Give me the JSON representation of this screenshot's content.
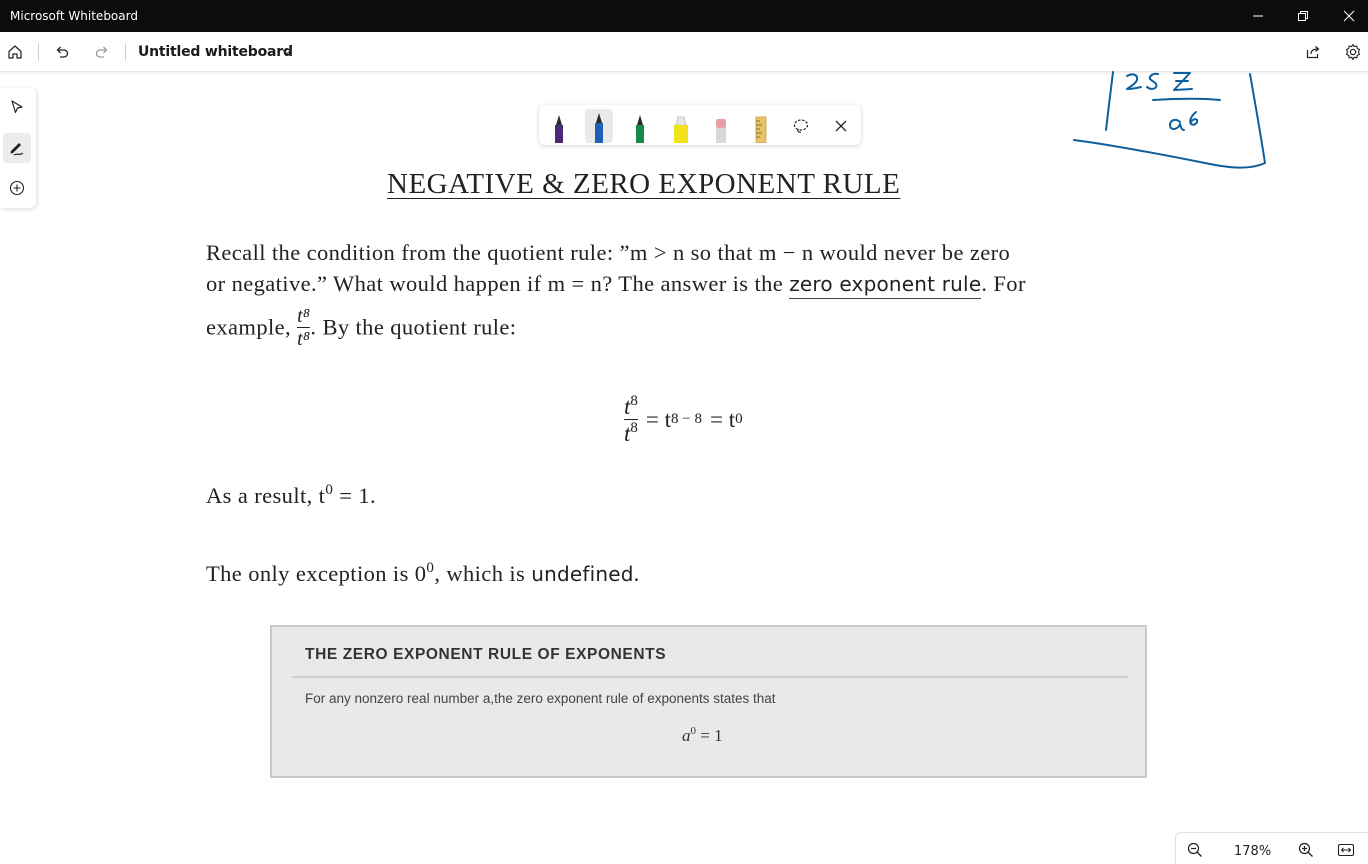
{
  "window": {
    "title": "Microsoft Whiteboard",
    "minimize_icon": "minimize-icon",
    "restore_icon": "restore-icon",
    "close_icon": "close-icon"
  },
  "appbar": {
    "home_icon": "home-icon",
    "undo_icon": "undo-icon",
    "redo_icon": "redo-icon",
    "whiteboard_title": "Untitled whiteboard",
    "share_icon": "share-icon",
    "settings_icon": "gear-icon"
  },
  "tool_rail": {
    "items": [
      {
        "name": "select",
        "icon": "pointer-icon",
        "active": false
      },
      {
        "name": "inking",
        "icon": "pen-icon",
        "active": true
      },
      {
        "name": "create",
        "icon": "add-icon",
        "active": false
      }
    ]
  },
  "pen_toolbar": {
    "pens": [
      {
        "name": "purple-pen",
        "color": "#4b2a7a",
        "active": false
      },
      {
        "name": "blue-pen",
        "color": "#1f5fb5",
        "active": true
      },
      {
        "name": "green-pen",
        "color": "#1a8a4a",
        "active": false
      },
      {
        "name": "highlighter",
        "color": "#f3e21a",
        "active": false
      },
      {
        "name": "eraser",
        "color": "#e8a0a6",
        "active": false
      },
      {
        "name": "ruler",
        "color": "#e8c26a",
        "active": false
      }
    ],
    "lasso_icon": "lasso-icon",
    "close_icon": "close-icon"
  },
  "document": {
    "heading": "NEGATIVE & ZERO EXPONENT RULE",
    "p1_line1": "Recall the condition from the quotient rule: ”m > n so that m − n would never be zero",
    "p1_line2_a": "or negative.” What would happen if m = n? The answer is the",
    "p1_line2_link": "zero exponent rule",
    "p1_line2_b": ". For",
    "p1_line3_a": "example,",
    "frac_num": "t⁸",
    "frac_den": "t⁸",
    "p1_line3_b": ". By the quotient rule:",
    "eq_num": "t",
    "eq_num_exp": "8",
    "eq_den": "t",
    "eq_den_exp": "8",
    "eq_mid": "= t",
    "eq_mid_exp": "8 − 8",
    "eq_end": "= t",
    "eq_end_exp": "0",
    "result_a": "As a result, t",
    "result_exp": "0",
    "result_b": " = 1.",
    "exception_a": "The only exception is 0",
    "exception_exp": "0",
    "exception_b": ", which is",
    "exception_bold": "undefined",
    "exception_c": "."
  },
  "rule_box": {
    "title": "THE ZERO EXPONENT RULE OF EXPONENTS",
    "text": "For any nonzero real number a,the zero exponent rule of exponents states that",
    "equation_base": "a",
    "equation_exp": "0",
    "equation_rest": " = 1"
  },
  "ink_annotation": {
    "text": "25 z / a^6",
    "color": "#0d5f9c"
  },
  "zoom": {
    "zoom_out_icon": "zoom-out-icon",
    "level": "178%",
    "zoom_in_icon": "zoom-in-icon",
    "fit_icon": "fit-width-icon"
  }
}
